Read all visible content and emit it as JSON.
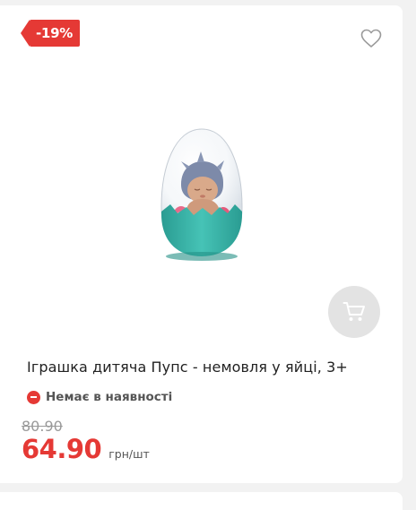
{
  "product": {
    "discount_badge": "-19%",
    "title": "Іграшка дитяча Пупс - немовля у яйці, 3+",
    "availability": "Немає в наявності",
    "old_price": "80.90",
    "price": "64.90",
    "price_unit": "грн/шт"
  },
  "icons": {
    "favorite": "heart-outline-icon",
    "cart": "shopping-cart-icon",
    "availability": "minus-circle-icon"
  },
  "colors": {
    "accent": "#e53935",
    "cart_button_bg": "#e3e3e3",
    "capsule_base": "#3fb7ac"
  }
}
